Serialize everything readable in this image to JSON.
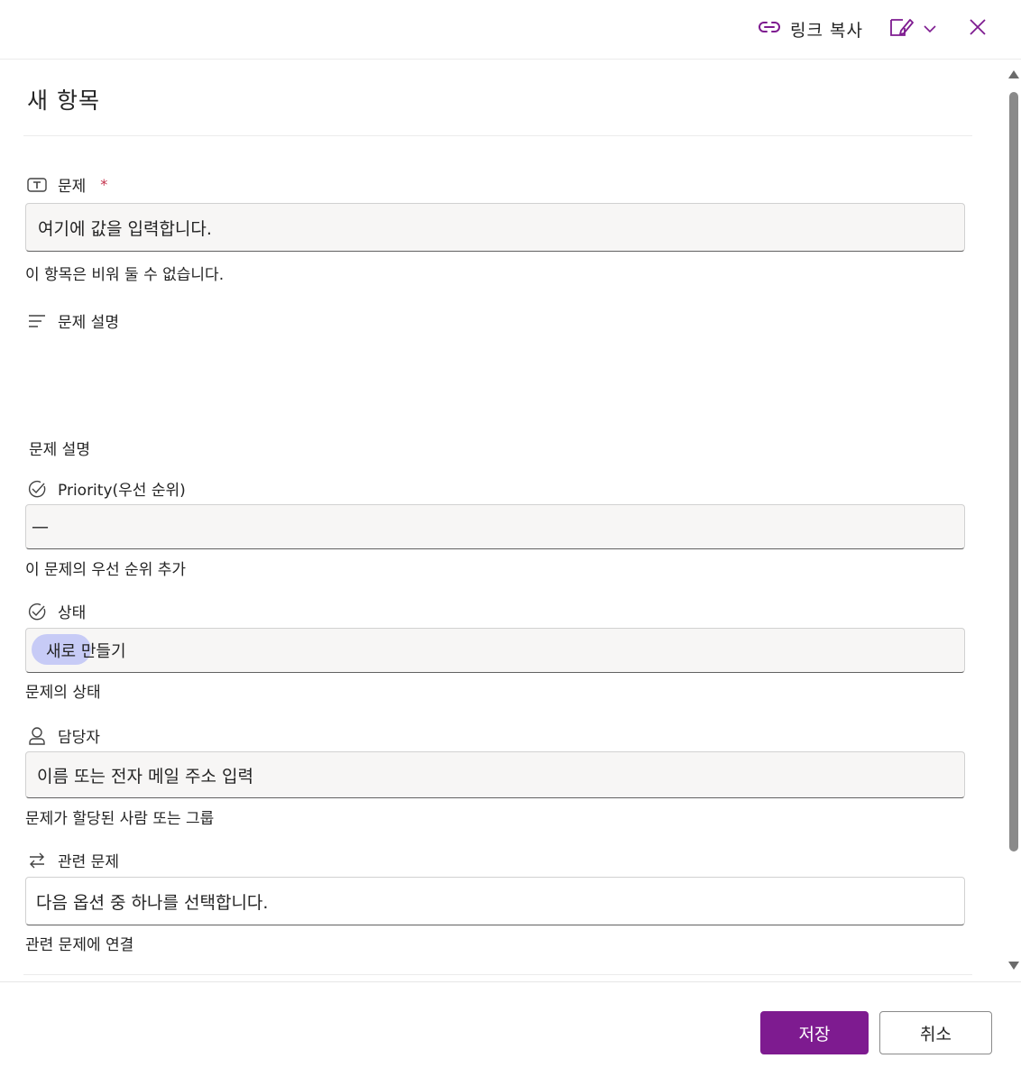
{
  "header": {
    "copy_link_label": "링크 복사",
    "icons": [
      "link-icon",
      "form-edit-icon",
      "chevron-down-icon",
      "close-icon"
    ]
  },
  "page": {
    "title": "새 항목"
  },
  "fields": {
    "title": {
      "label": "문제",
      "required_mark": "*",
      "placeholder": "여기에 값을 입력합니다.",
      "hint": "이 항목은 비워 둘 수 없습니다.",
      "icon": "text-field-icon"
    },
    "description": {
      "label": "문제 설명",
      "hint": "문제 설명",
      "icon": "multiline-text-icon"
    },
    "priority": {
      "label": "Priority(우선 순위)",
      "value": "—",
      "hint": "이 문제의 우선 순위 추가",
      "icon": "choice-check-icon"
    },
    "status": {
      "label": "상태",
      "value": "새로 만들기",
      "hint": "문제의 상태",
      "icon": "choice-check-icon"
    },
    "assigned_to": {
      "label": "담당자",
      "placeholder": "이름 또는 전자 메일 주소 입력",
      "hint": "문제가 할당된 사람 또는 그룹",
      "icon": "person-icon"
    },
    "related": {
      "label": "관련 문제",
      "placeholder": "다음 옵션 중 하나를 선택합니다.",
      "hint": "관련 문제에 연결",
      "icon": "arrows-swap-icon"
    }
  },
  "footer": {
    "save_label": "저장",
    "cancel_label": "취소"
  },
  "colors": {
    "accent": "#7e1b90",
    "status_bubble": "#c7cbf6",
    "required": "#c4314b"
  }
}
